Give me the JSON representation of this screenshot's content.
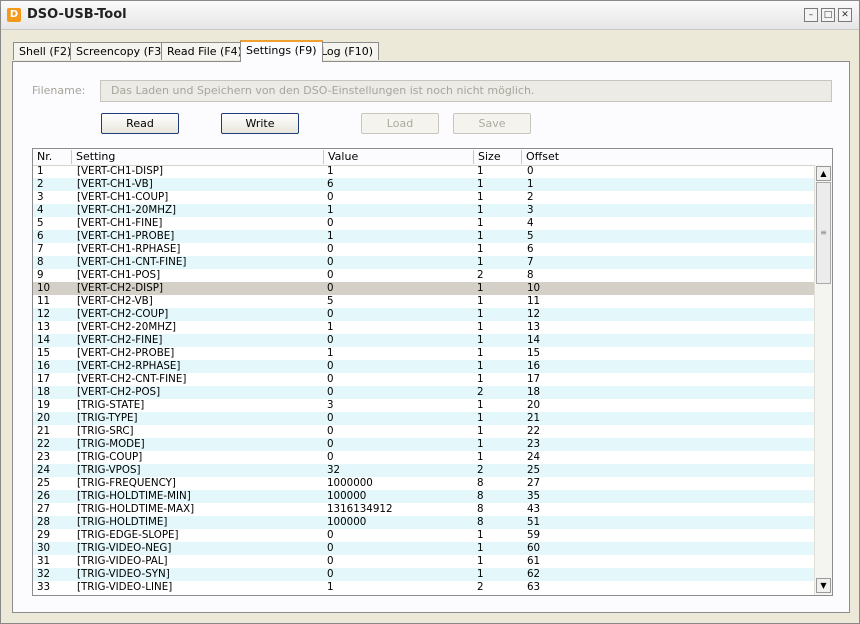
{
  "window": {
    "title": "DSO-USB-Tool",
    "app_icon": "D"
  },
  "tabs": [
    {
      "label": "Shell (F2)"
    },
    {
      "label": "Screencopy (F3)"
    },
    {
      "label": "Read File (F4)"
    },
    {
      "label": "Settings (F9)",
      "active": true
    },
    {
      "label": "Log (F10)"
    }
  ],
  "file": {
    "label": "Filename:",
    "value": "Das Laden und Speichern von den DSO-Einstellungen ist noch nicht möglich."
  },
  "buttons": {
    "read": "Read",
    "write": "Write",
    "load": "Load",
    "save": "Save"
  },
  "table": {
    "columns": [
      "Nr.",
      "Setting",
      "Value",
      "Size",
      "Offset"
    ],
    "selected_row": 10,
    "rows": [
      [
        "1",
        "[VERT-CH1-DISP]",
        "1",
        "1",
        "0"
      ],
      [
        "2",
        "[VERT-CH1-VB]",
        "6",
        "1",
        "1"
      ],
      [
        "3",
        "[VERT-CH1-COUP]",
        "0",
        "1",
        "2"
      ],
      [
        "4",
        "[VERT-CH1-20MHZ]",
        "1",
        "1",
        "3"
      ],
      [
        "5",
        "[VERT-CH1-FINE]",
        "0",
        "1",
        "4"
      ],
      [
        "6",
        "[VERT-CH1-PROBE]",
        "1",
        "1",
        "5"
      ],
      [
        "7",
        "[VERT-CH1-RPHASE]",
        "0",
        "1",
        "6"
      ],
      [
        "8",
        "[VERT-CH1-CNT-FINE]",
        "0",
        "1",
        "7"
      ],
      [
        "9",
        "[VERT-CH1-POS]",
        "0",
        "2",
        "8"
      ],
      [
        "10",
        "[VERT-CH2-DISP]",
        "0",
        "1",
        "10"
      ],
      [
        "11",
        "[VERT-CH2-VB]",
        "5",
        "1",
        "11"
      ],
      [
        "12",
        "[VERT-CH2-COUP]",
        "0",
        "1",
        "12"
      ],
      [
        "13",
        "[VERT-CH2-20MHZ]",
        "1",
        "1",
        "13"
      ],
      [
        "14",
        "[VERT-CH2-FINE]",
        "0",
        "1",
        "14"
      ],
      [
        "15",
        "[VERT-CH2-PROBE]",
        "1",
        "1",
        "15"
      ],
      [
        "16",
        "[VERT-CH2-RPHASE]",
        "0",
        "1",
        "16"
      ],
      [
        "17",
        "[VERT-CH2-CNT-FINE]",
        "0",
        "1",
        "17"
      ],
      [
        "18",
        "[VERT-CH2-POS]",
        "0",
        "2",
        "18"
      ],
      [
        "19",
        "[TRIG-STATE]",
        "3",
        "1",
        "20"
      ],
      [
        "20",
        "[TRIG-TYPE]",
        "0",
        "1",
        "21"
      ],
      [
        "21",
        "[TRIG-SRC]",
        "0",
        "1",
        "22"
      ],
      [
        "22",
        "[TRIG-MODE]",
        "0",
        "1",
        "23"
      ],
      [
        "23",
        "[TRIG-COUP]",
        "0",
        "1",
        "24"
      ],
      [
        "24",
        "[TRIG-VPOS]",
        "32",
        "2",
        "25"
      ],
      [
        "25",
        "[TRIG-FREQUENCY]",
        "1000000",
        "8",
        "27"
      ],
      [
        "26",
        "[TRIG-HOLDTIME-MIN]",
        "100000",
        "8",
        "35"
      ],
      [
        "27",
        "[TRIG-HOLDTIME-MAX]",
        "1316134912",
        "8",
        "43"
      ],
      [
        "28",
        "[TRIG-HOLDTIME]",
        "100000",
        "8",
        "51"
      ],
      [
        "29",
        "[TRIG-EDGE-SLOPE]",
        "0",
        "1",
        "59"
      ],
      [
        "30",
        "[TRIG-VIDEO-NEG]",
        "0",
        "1",
        "60"
      ],
      [
        "31",
        "[TRIG-VIDEO-PAL]",
        "0",
        "1",
        "61"
      ],
      [
        "32",
        "[TRIG-VIDEO-SYN]",
        "0",
        "1",
        "62"
      ],
      [
        "33",
        "[TRIG-VIDEO-LINE]",
        "1",
        "2",
        "63"
      ]
    ]
  }
}
